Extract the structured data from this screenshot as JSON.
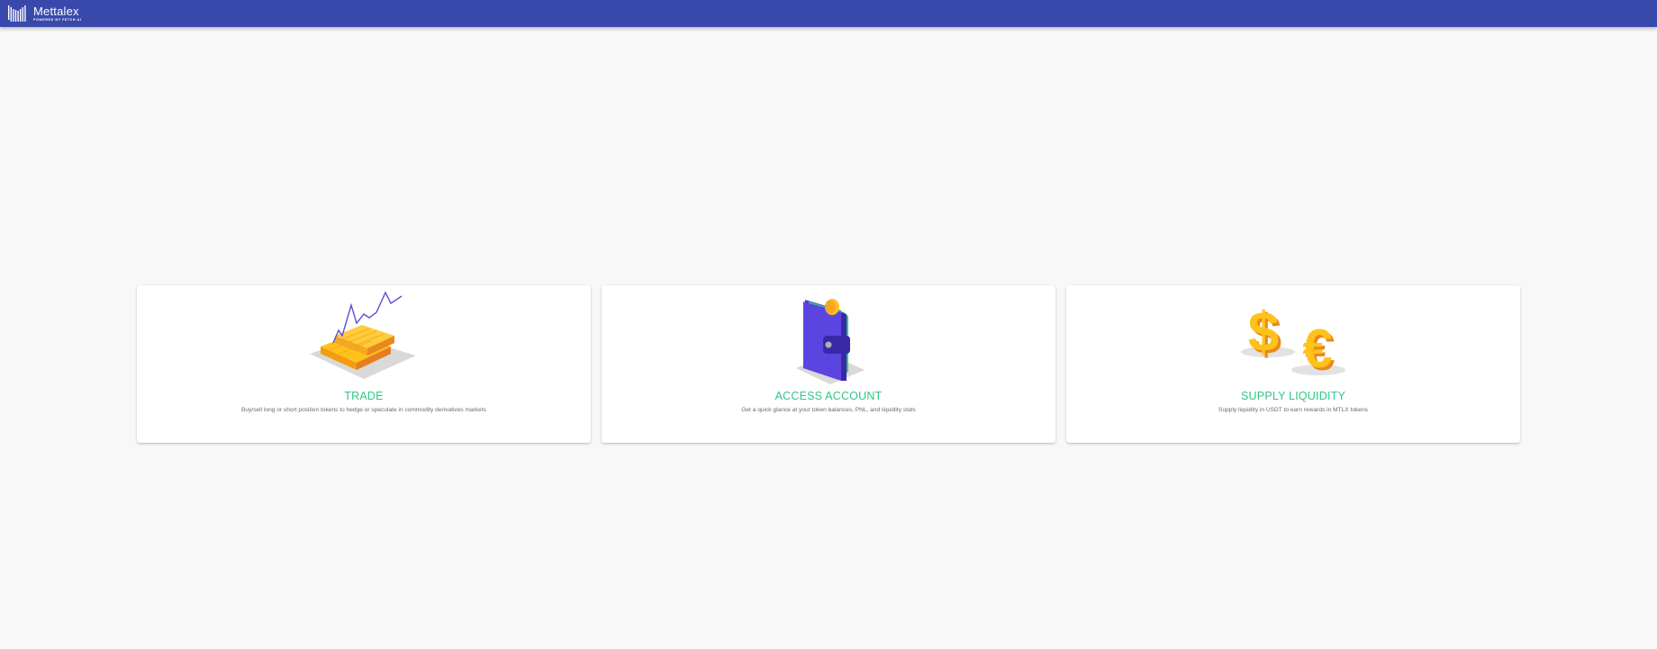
{
  "appbar": {
    "brand_name": "Mettalex",
    "brand_tagline": "POWERED BY FETCH.AI",
    "logo_icon": "barcode-bars-logo",
    "background_color": "#3949ab"
  },
  "cards": [
    {
      "title": "TRADE",
      "description": "Buy/sell long or short position tokens to hedge or speculate in commodity derivatives markets",
      "illustration_icon": "gold-bars-chart-icon"
    },
    {
      "title": "ACCESS ACCOUNT",
      "description": "Get a quick glance at your token balances, PNL, and liquidity stats",
      "illustration_icon": "wallet-icon"
    },
    {
      "title": "SUPPLY LIQUIDITY",
      "description": "Supply liquidity in USDT to earn rewards in MTLX tokens",
      "illustration_icon": "dollar-euro-icon"
    }
  ],
  "colors": {
    "accent_title": "#2fc787",
    "page_background": "#f8f8f8",
    "card_background": "#ffffff"
  }
}
